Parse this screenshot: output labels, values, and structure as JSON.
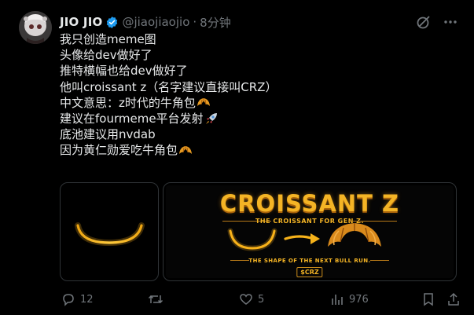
{
  "tweet": {
    "author_name": "JIO JIO",
    "handle": "@jiaojiaojio",
    "separator": "·",
    "time": "8分钟",
    "lines": [
      {
        "text": "我只创造meme图",
        "emoji": ""
      },
      {
        "text": "头像给dev做好了",
        "emoji": ""
      },
      {
        "text": "推特横幅也给dev做好了",
        "emoji": ""
      },
      {
        "text": "他叫croissant z（名字建议直接叫CRZ）",
        "emoji": ""
      },
      {
        "text": "中文意思：z时代的牛角包",
        "emoji": "croissant-icon"
      },
      {
        "text": "建议在fourmeme平台发射",
        "emoji": "rocket-icon"
      },
      {
        "text": "底池建议用nvdab",
        "emoji": ""
      },
      {
        "text": "因为黄仁勋爱吃牛角包",
        "emoji": "croissant-icon"
      }
    ]
  },
  "banner": {
    "title": "CROISSANT Z",
    "subtitle": "THE CROISSANT FOR GEN Z.",
    "tagline": "THE SHAPE OF THE NEXT BULL RUN.",
    "ticker": "$CRZ"
  },
  "actions": {
    "replies": "12",
    "retweets": "",
    "likes": "5",
    "views": "976"
  },
  "colors": {
    "background": "#000000",
    "text": "#e7e9ea",
    "muted": "#71767b",
    "verified": "#1d9bf0",
    "accent_gold": "#f4b425"
  }
}
